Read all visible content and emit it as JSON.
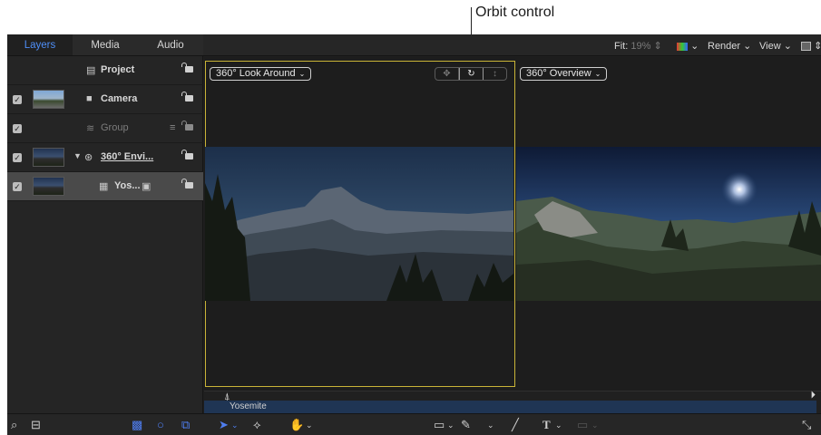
{
  "callout": {
    "label": "Orbit control"
  },
  "tabs": [
    {
      "label": "Layers",
      "active": true
    },
    {
      "label": "Media",
      "active": false
    },
    {
      "label": "Audio",
      "active": false
    }
  ],
  "toolbar": {
    "fit_label": "Fit:",
    "fit_value": "19%",
    "render_label": "Render",
    "view_label": "View"
  },
  "layers": [
    {
      "name": "Project",
      "icon": "document-icon",
      "checked": false,
      "thumb": false,
      "dim": false,
      "selected": false
    },
    {
      "name": "Camera",
      "icon": "camera-icon",
      "checked": true,
      "thumb": true,
      "dim": false,
      "selected": false
    },
    {
      "name": "Group",
      "icon": "group-icon",
      "checked": true,
      "thumb": false,
      "dim": true,
      "selected": false
    },
    {
      "name": "360° Envi...",
      "icon": "360-environment-icon",
      "checked": true,
      "thumb": true,
      "dim": false,
      "selected": false
    },
    {
      "name": "Yos...",
      "icon": "film-icon",
      "checked": true,
      "thumb": true,
      "dim": false,
      "selected": true
    }
  ],
  "canvas": {
    "left_view_label": "360° Look Around",
    "right_view_label": "360° Overview"
  },
  "timeline": {
    "clip_label": "Yosemite"
  },
  "colors": {
    "accent": "#4e8ef7",
    "viewport_border": "#c9b437",
    "clip": "#1f3554"
  }
}
